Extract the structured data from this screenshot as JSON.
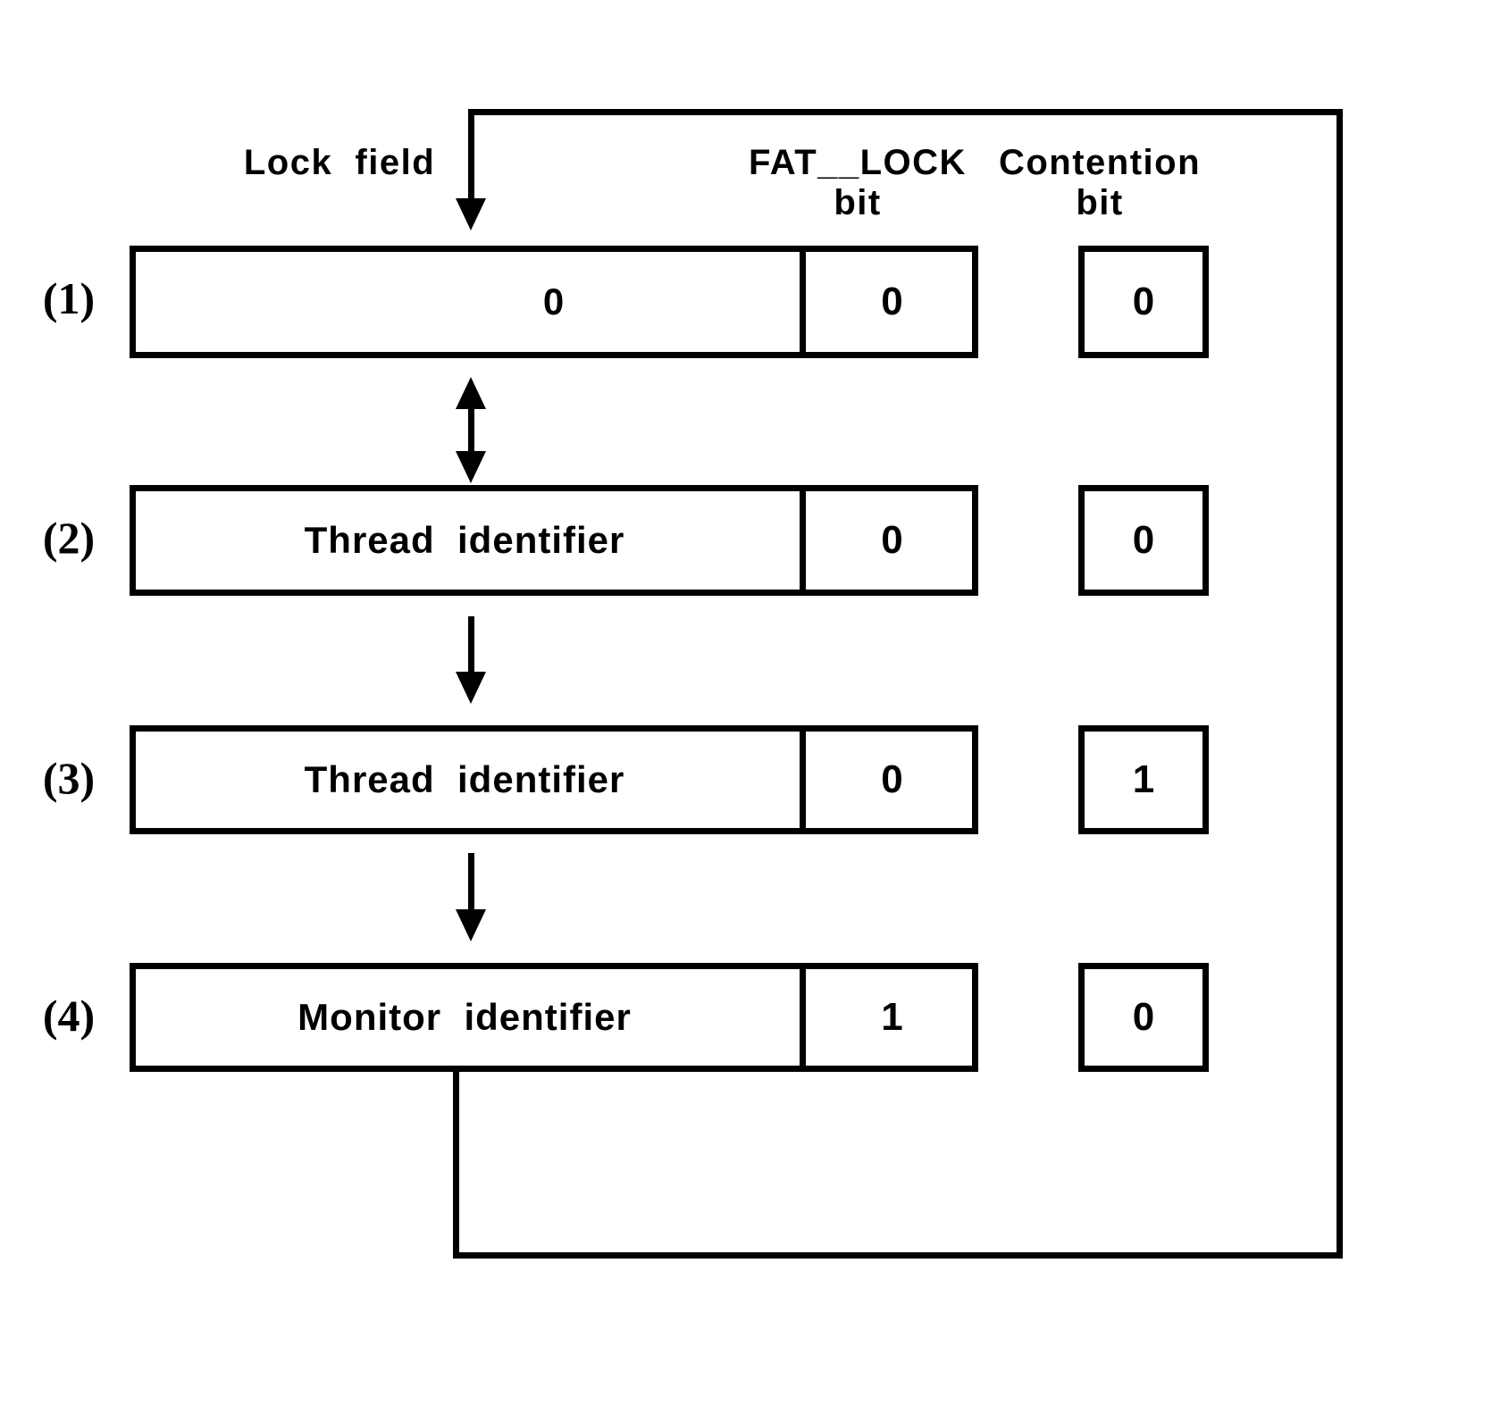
{
  "diagram": {
    "title_present": false,
    "headers": {
      "lock_field": "Lock  field",
      "fat_lock": "FAT__LOCK\nbit",
      "contention": "Contention\nbit"
    },
    "rows": [
      {
        "marker": "(1)",
        "lock_field_value": "0",
        "fat_lock_bit": "0",
        "contention_bit": "0"
      },
      {
        "marker": "(2)",
        "lock_field_value": "Thread  identifier",
        "fat_lock_bit": "0",
        "contention_bit": "0"
      },
      {
        "marker": "(3)",
        "lock_field_value": "Thread  identifier",
        "fat_lock_bit": "0",
        "contention_bit": "1"
      },
      {
        "marker": "(4)",
        "lock_field_value": "Monitor  identifier",
        "fat_lock_bit": "1",
        "contention_bit": "0"
      }
    ],
    "connectors": [
      {
        "name": "entry-arrow-into-row-1",
        "from": "feedback-loop",
        "to": "(1)",
        "direction": "down"
      },
      {
        "name": "row1-row2-bidirectional",
        "from": "(1)",
        "to": "(2)",
        "direction": "both"
      },
      {
        "name": "row2-row3-arrow",
        "from": "(2)",
        "to": "(3)",
        "direction": "down"
      },
      {
        "name": "row3-row4-arrow",
        "from": "(3)",
        "to": "(4)",
        "direction": "down"
      },
      {
        "name": "feedback-loop-row4-to-row1",
        "from": "(4)",
        "to": "(1)",
        "direction": "loop"
      }
    ],
    "colors": {
      "ink": "#000000",
      "paper": "#ffffff"
    }
  }
}
